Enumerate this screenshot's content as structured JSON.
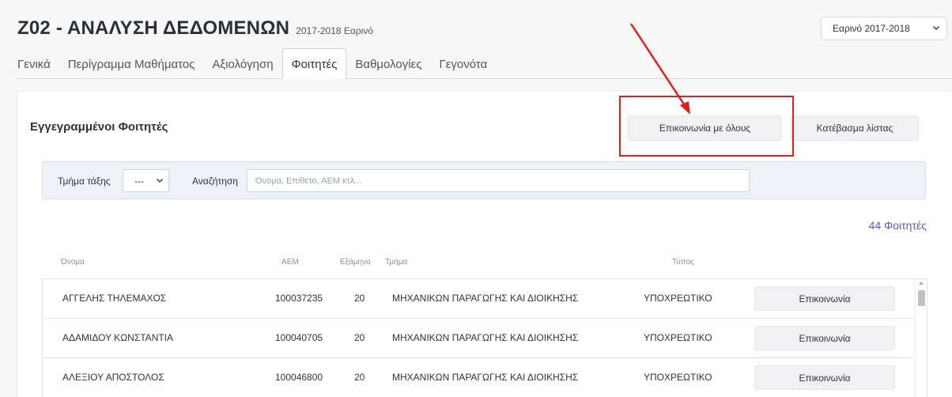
{
  "course": {
    "title": "Ζ02 - ΑΝΑΛΥΣΗ ΔΕΔΟΜΕΝΩΝ",
    "subtitle": "2017-2018 Εαρινό"
  },
  "semester_select": {
    "value": "Εαρινό 2017-2018"
  },
  "tabs": [
    {
      "label": "Γενικά"
    },
    {
      "label": "Περίγραμμα Μαθήματος"
    },
    {
      "label": "Αξιολόγηση"
    },
    {
      "label": "Φοιτητές",
      "active": true
    },
    {
      "label": "Βαθμολογίες"
    },
    {
      "label": "Γεγονότα"
    }
  ],
  "section": {
    "title": "Εγγεγραμμένοι Φοιτητές",
    "contact_all_label": "Επικοινωνία με όλους",
    "download_label": "Κατέβασμα λίστας"
  },
  "filters": {
    "section_label": "Τμήμα τάξης",
    "section_value": "---",
    "search_label": "Αναζήτηση",
    "search_placeholder": "Όνομα, Επίθετο, ΑΕΜ κτλ..."
  },
  "count_text": "44 Φοιτητές",
  "columns": {
    "name": "Όνομα",
    "aem": "ΑΕΜ",
    "semester": "Εξάμηνο",
    "department": "Τμήμα",
    "type": "Τύπος"
  },
  "rows": [
    {
      "name": "ΑΓΓΕΛΗΣ ΤΗΛΕΜΑΧΟΣ",
      "aem": "100037235",
      "semester": "20",
      "department": "ΜΗΧΑΝΙΚΩΝ ΠΑΡΑΓΩΓΗΣ ΚΑΙ ΔΙΟΙΚΗΣΗΣ",
      "type": "ΥΠΟΧΡΕΩΤΙΚΟ",
      "action": "Επικοινωνία"
    },
    {
      "name": "ΑΔΑΜΙΔΟΥ ΚΩΝΣΤΑΝΤΙΑ",
      "aem": "100040705",
      "semester": "20",
      "department": "ΜΗΧΑΝΙΚΩΝ ΠΑΡΑΓΩΓΗΣ ΚΑΙ ΔΙΟΙΚΗΣΗΣ",
      "type": "ΥΠΟΧΡΕΩΤΙΚΟ",
      "action": "Επικοινωνία"
    },
    {
      "name": "ΑΛΕΞΙΟΥ ΑΠΟΣΤΟΛΟΣ",
      "aem": "100046800",
      "semester": "20",
      "department": "ΜΗΧΑΝΙΚΩΝ ΠΑΡΑΓΩΓΗΣ ΚΑΙ ΔΙΟΙΚΗΣΗΣ",
      "type": "ΥΠΟΧΡΕΩΤΙΚΟ",
      "action": "Επικοινωνία"
    }
  ],
  "colors": {
    "annotation": "#e0201c",
    "count_link": "#5b56c8",
    "filter_bg": "#eef2f6"
  },
  "icons": {
    "semester_caret": "chevron-down-icon",
    "section_caret": "chevron-down-icon",
    "annotation_arrow": "red-arrow-icon"
  }
}
